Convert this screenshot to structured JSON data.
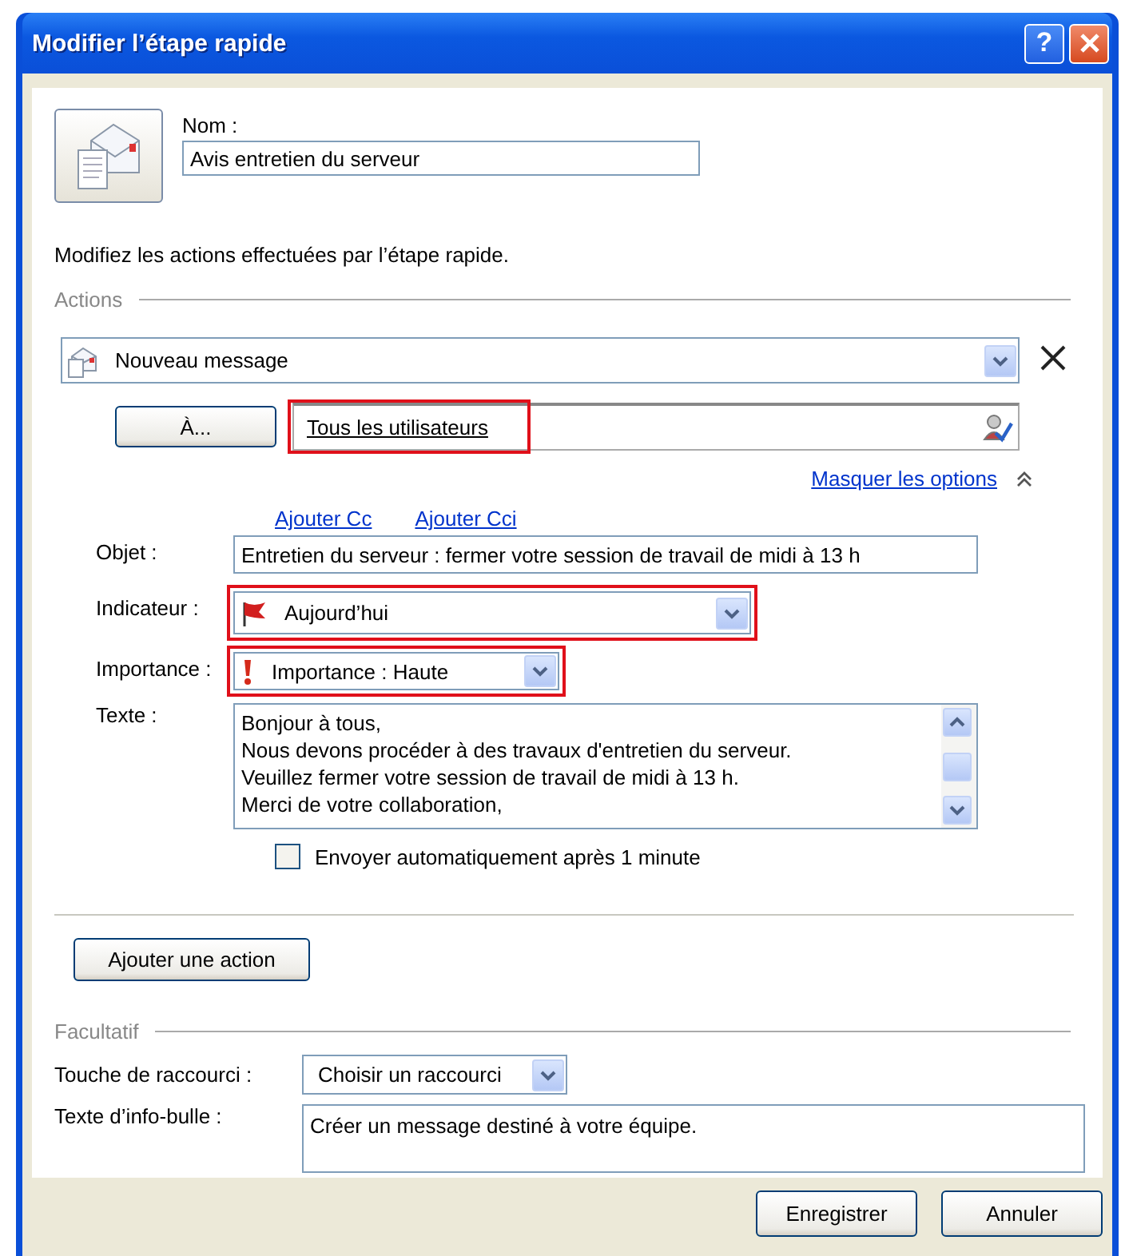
{
  "window": {
    "title": "Modifier l’étape rapide",
    "help_button": "?"
  },
  "name_field": {
    "label": "Nom :",
    "value": "Avis entretien du serveur"
  },
  "description": "Modifiez les actions effectuées par l’étape rapide.",
  "actions_group": {
    "title": "Actions"
  },
  "action": {
    "type": "Nouveau message",
    "to_button": "À...",
    "to_field": {
      "value": "Tous les utilisateurs",
      "highlighted": true
    },
    "hide_options": "Masquer les options",
    "links": [
      "Ajouter Cc",
      "Ajouter Cci"
    ],
    "subject": {
      "label": "Objet :",
      "value": "Entretien du serveur : fermer votre session de travail de midi à 13 h"
    },
    "flag": {
      "label": "Indicateur :",
      "value": "Aujourd’hui",
      "highlighted": true
    },
    "importance": {
      "label": "Importance :",
      "value": "Importance : Haute",
      "highlighted": true
    },
    "body": {
      "label": "Texte :",
      "lines": [
        "Bonjour à tous,",
        "Nous devons procéder à des travaux d'entretien du serveur.",
        "Veuillez fermer votre session de travail de midi à 13 h.",
        "Merci de votre collaboration,"
      ]
    },
    "auto_send": {
      "label": "Envoyer automatiquement après 1 minute",
      "checked": false
    }
  },
  "add_action_button": "Ajouter une action",
  "optional_group": {
    "title": "Facultatif",
    "shortcut": {
      "label": "Touche de raccourci :",
      "value": "Choisir un raccourci"
    },
    "tooltip": {
      "label": "Texte d’info-bulle :",
      "value": "Créer un message destiné à votre équipe."
    }
  },
  "buttons": [
    {
      "label": "Enregistrer"
    },
    {
      "label": "Annuler"
    }
  ]
}
